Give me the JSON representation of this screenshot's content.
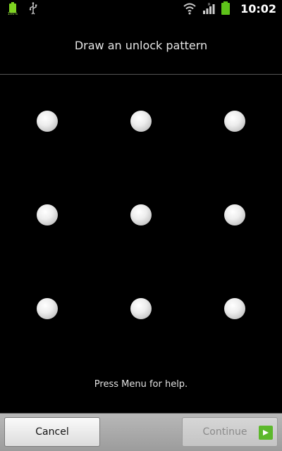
{
  "status_bar": {
    "battery_small_text": "100%",
    "time": "10:02",
    "icons": [
      "battery-small-icon",
      "usb-icon",
      "wifi-icon",
      "signal-icon",
      "battery-icon"
    ]
  },
  "screen": {
    "title": "Draw an unlock pattern",
    "help": "Press Menu for help."
  },
  "pattern": {
    "dots": 9,
    "rows": 3,
    "cols": 3
  },
  "buttons": {
    "cancel": "Cancel",
    "continue": "Continue"
  },
  "colors": {
    "background": "#000000",
    "battery": "#5ec21a",
    "continue_arrow": "#5cb82b"
  }
}
